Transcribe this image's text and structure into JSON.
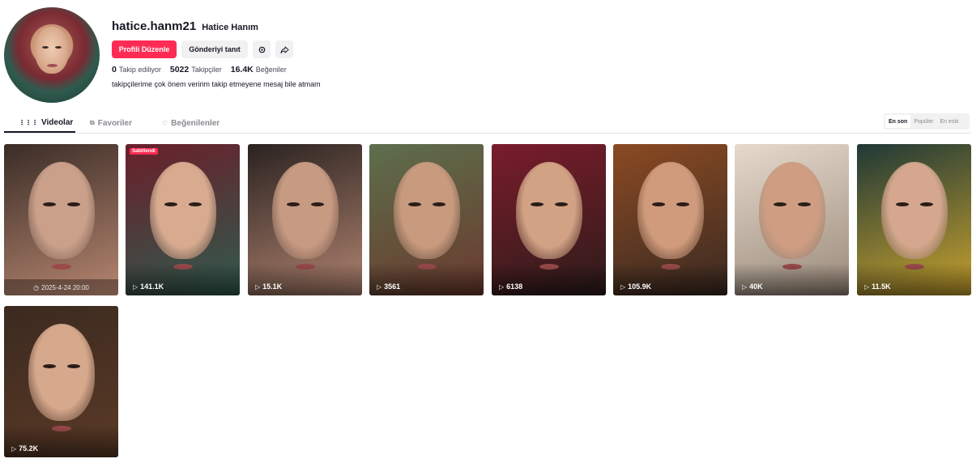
{
  "profile": {
    "username": "hatice.hanm21",
    "nickname": "Hatice Hanım",
    "bio": "takipçilerime çok önem veririm takip etmeyene mesaj bile atmam"
  },
  "actions": {
    "edit_label": "Profili Düzenle",
    "promote_label": "Gönderiyi tanıt",
    "settings_icon": "gear-icon",
    "share_icon": "share-icon"
  },
  "stats": {
    "following_count": "0",
    "following_label": "Takip ediliyor",
    "followers_count": "5022",
    "followers_label": "Takipçiler",
    "likes_count": "16.4K",
    "likes_label": "Beğeniler"
  },
  "tabs": {
    "videos": "Videolar",
    "favorites": "Favoriler",
    "liked": "Beğenilenler"
  },
  "sort": {
    "latest": "En son",
    "popular": "Popüler",
    "oldest": "En eski",
    "selected": "En son"
  },
  "colors": {
    "accent": "#fe2c55"
  },
  "videos": [
    {
      "label": "2025-4-24 20:00",
      "kind": "scheduled"
    },
    {
      "label": "141.1K",
      "kind": "views",
      "pinned": "Sabitlendi"
    },
    {
      "label": "15.1K",
      "kind": "views"
    },
    {
      "label": "3561",
      "kind": "views"
    },
    {
      "label": "6138",
      "kind": "views"
    },
    {
      "label": "105.9K",
      "kind": "views"
    },
    {
      "label": "40K",
      "kind": "views"
    },
    {
      "label": "11.5K",
      "kind": "views"
    },
    {
      "label": "75.2K",
      "kind": "views"
    }
  ]
}
